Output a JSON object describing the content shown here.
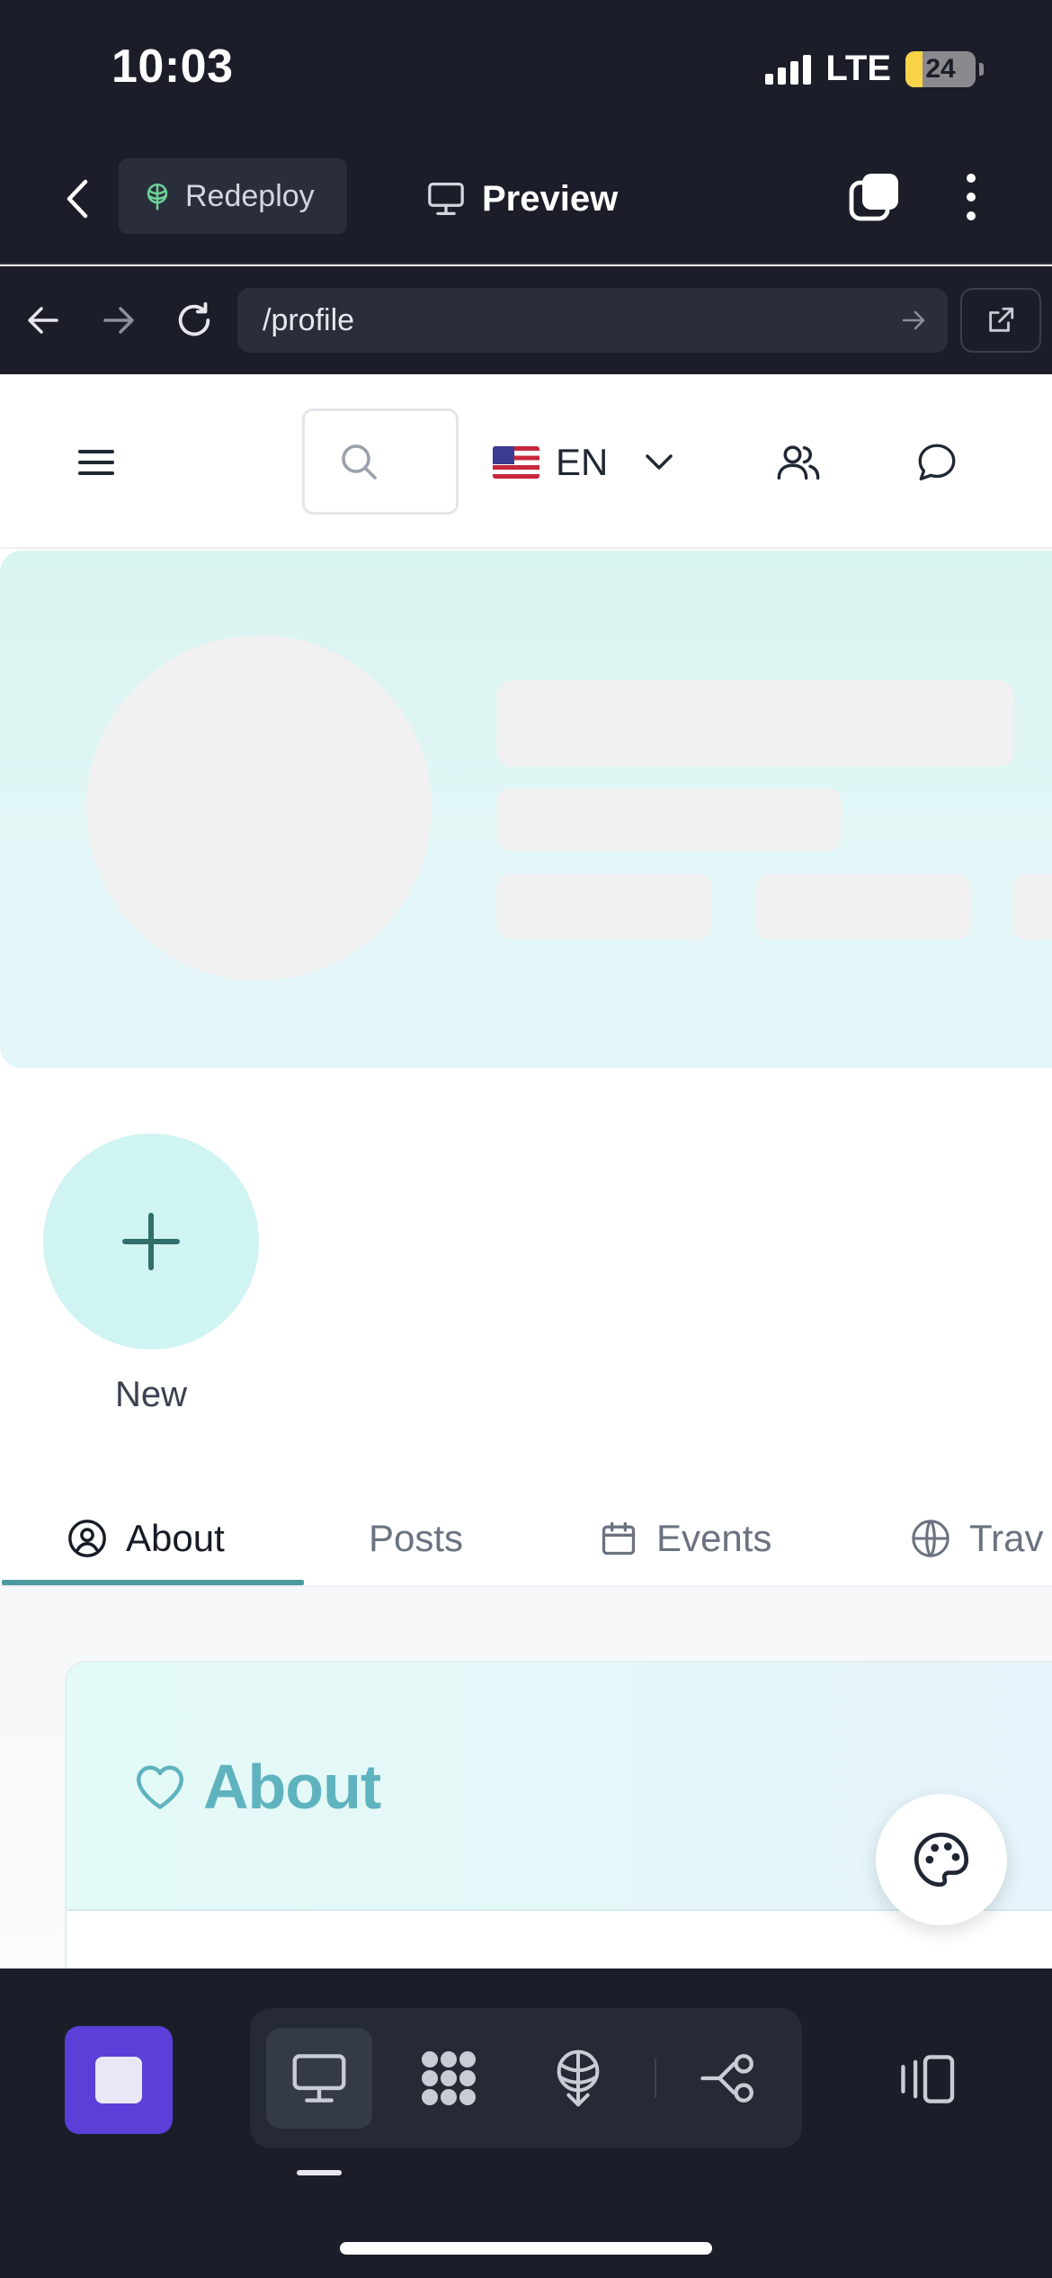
{
  "status_bar": {
    "time": "10:03",
    "network": "LTE",
    "battery_level": "24",
    "battery_fraction": 0.24
  },
  "app_bar": {
    "redeploy_label": "Redeploy",
    "preview_label": "Preview"
  },
  "url_bar": {
    "path": "/profile"
  },
  "site_header": {
    "language_code": "EN",
    "language_flag": "us-flag",
    "search_placeholder": ""
  },
  "profile": {
    "new_story_label": "New"
  },
  "tabs": [
    {
      "label": "About",
      "icon": "user-circle-icon",
      "active": true
    },
    {
      "label": "Posts",
      "icon": "",
      "active": false
    },
    {
      "label": "Events",
      "icon": "calendar-icon",
      "active": false
    },
    {
      "label": "Trav",
      "icon": "globe-icon",
      "active": false
    }
  ],
  "about_section": {
    "title": "About",
    "icon": "heart-icon"
  },
  "colors": {
    "chrome_bg": "#1b1e28",
    "accent_teal": "#5fb3bf",
    "tab_underline": "#4b9aa0",
    "stop_button": "#5b3fd8",
    "hero_bg": "#d8f4f0"
  }
}
